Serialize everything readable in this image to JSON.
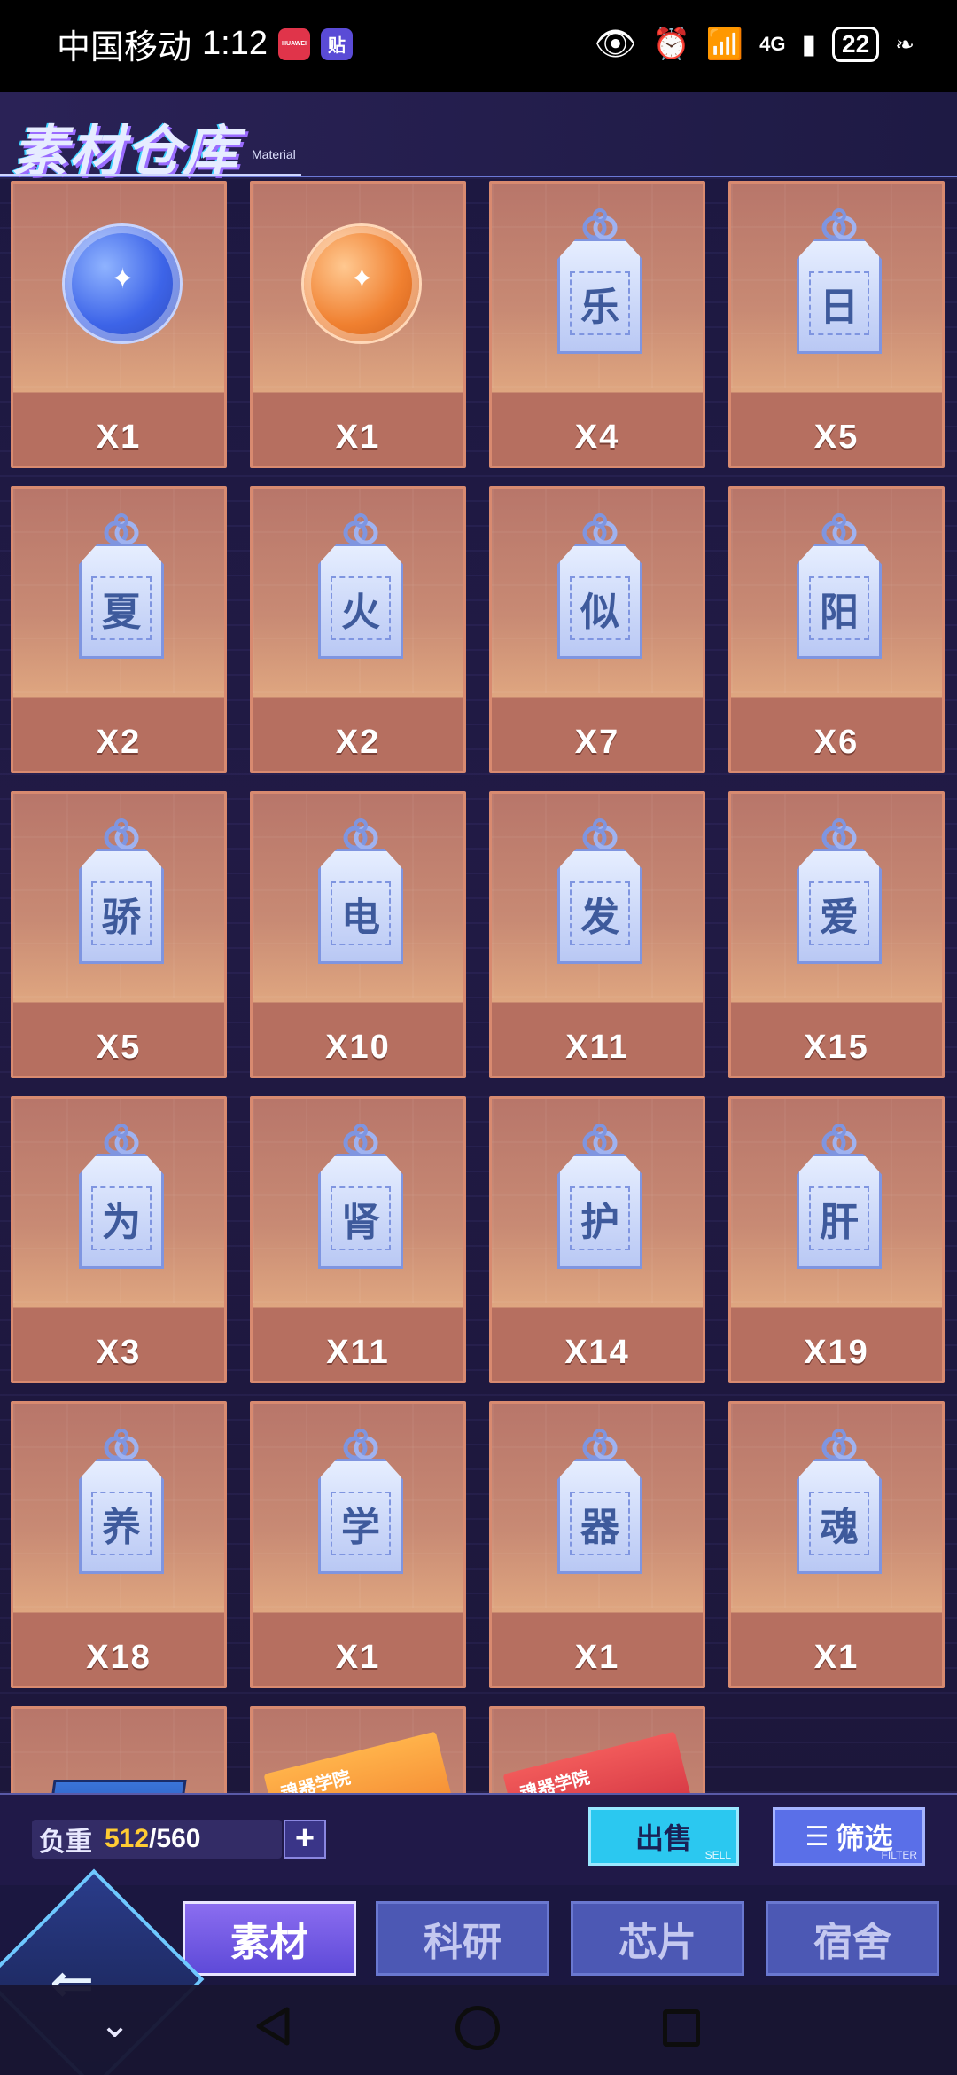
{
  "status_bar": {
    "carrier": "中国移动",
    "time": "1:12",
    "badge1": "HUAWEI",
    "badge2": "贴",
    "network": "4G",
    "battery": "22"
  },
  "header": {
    "title": "素材仓库",
    "subtitle": "Material"
  },
  "items": [
    {
      "kind": "bubble-blue",
      "count": "X1"
    },
    {
      "kind": "bubble-orange",
      "count": "X1"
    },
    {
      "kind": "tag",
      "char": "乐",
      "count": "X4"
    },
    {
      "kind": "tag",
      "char": "日",
      "count": "X5"
    },
    {
      "kind": "tag",
      "char": "夏",
      "count": "X2"
    },
    {
      "kind": "tag",
      "char": "火",
      "count": "X2"
    },
    {
      "kind": "tag",
      "char": "似",
      "count": "X7"
    },
    {
      "kind": "tag",
      "char": "阳",
      "count": "X6"
    },
    {
      "kind": "tag",
      "char": "骄",
      "count": "X5"
    },
    {
      "kind": "tag",
      "char": "电",
      "count": "X10"
    },
    {
      "kind": "tag",
      "char": "发",
      "count": "X11"
    },
    {
      "kind": "tag",
      "char": "爱",
      "count": "X15"
    },
    {
      "kind": "tag",
      "char": "为",
      "count": "X3"
    },
    {
      "kind": "tag",
      "char": "肾",
      "count": "X11"
    },
    {
      "kind": "tag",
      "char": "护",
      "count": "X14"
    },
    {
      "kind": "tag",
      "char": "肝",
      "count": "X19"
    },
    {
      "kind": "tag",
      "char": "养",
      "count": "X18"
    },
    {
      "kind": "tag",
      "char": "学",
      "count": "X1"
    },
    {
      "kind": "tag",
      "char": "器",
      "count": "X1"
    },
    {
      "kind": "tag",
      "char": "魂",
      "count": "X1"
    },
    {
      "kind": "box",
      "count": ""
    },
    {
      "kind": "book-orange",
      "label": "魂器学院",
      "count": ""
    },
    {
      "kind": "book-red",
      "label": "魂器学院",
      "count": ""
    }
  ],
  "capacity": {
    "label": "负重",
    "used": "512",
    "total": "/560",
    "plus": "+"
  },
  "actions": {
    "sell": "出售",
    "sell_en": "SELL",
    "filter": "筛选",
    "filter_en": "FILTER"
  },
  "tabs": [
    {
      "label": "素材",
      "active": true
    },
    {
      "label": "科研",
      "active": false
    },
    {
      "label": "芯片",
      "active": false
    },
    {
      "label": "宿舍",
      "active": false
    }
  ]
}
